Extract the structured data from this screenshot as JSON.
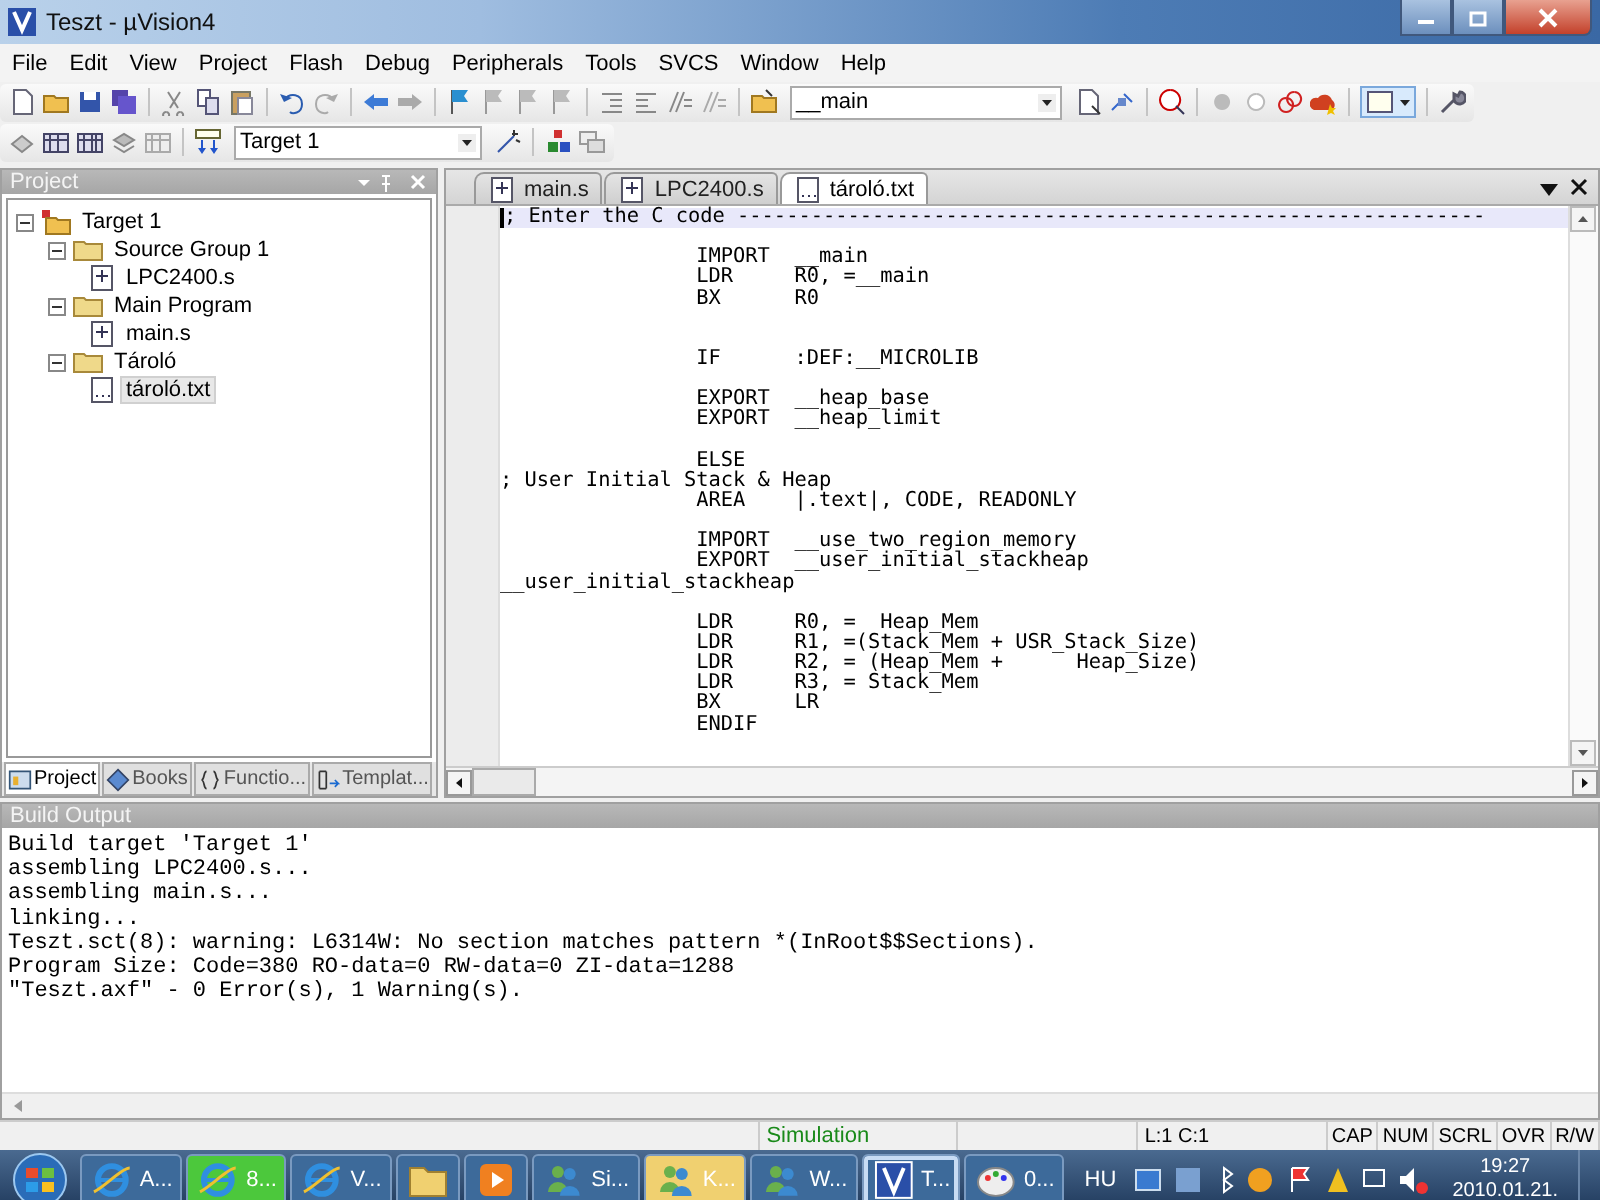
{
  "window": {
    "title": "Teszt  - µVision4"
  },
  "menu": [
    "File",
    "Edit",
    "View",
    "Project",
    "Flash",
    "Debug",
    "Peripherals",
    "Tools",
    "SVCS",
    "Window",
    "Help"
  ],
  "toolbar": {
    "function_combo": {
      "value": "__main"
    },
    "target_combo": {
      "value": "Target 1"
    }
  },
  "project_panel": {
    "title": "Project",
    "tree": [
      {
        "label": "Target 1",
        "kind": "target",
        "expanded": true,
        "selected": false,
        "children": [
          {
            "label": "Source Group 1",
            "kind": "group",
            "expanded": true,
            "selected": false,
            "children": [
              {
                "label": "LPC2400.s",
                "kind": "asm-file",
                "selected": false
              }
            ]
          },
          {
            "label": "Main Program",
            "kind": "group",
            "expanded": true,
            "selected": false,
            "children": [
              {
                "label": "main.s",
                "kind": "asm-file",
                "selected": false
              }
            ]
          },
          {
            "label": "Tároló",
            "kind": "group",
            "expanded": true,
            "selected": false,
            "children": [
              {
                "label": "tároló.txt",
                "kind": "text-file",
                "selected": true
              }
            ]
          }
        ]
      }
    ],
    "tabs": [
      {
        "label": "Project",
        "kind": "project",
        "selected": true
      },
      {
        "label": "Books",
        "kind": "books",
        "selected": false
      },
      {
        "label": "Functio...",
        "kind": "functions",
        "selected": false
      },
      {
        "label": "Templat...",
        "kind": "templates",
        "selected": false
      }
    ]
  },
  "editor": {
    "tabs": [
      {
        "label": "main.s",
        "kind": "asm-file",
        "selected": false
      },
      {
        "label": "LPC2400.s",
        "kind": "asm-file",
        "selected": false
      },
      {
        "label": "tároló.txt",
        "kind": "text-file",
        "selected": true
      }
    ],
    "lines": [
      {
        "kind": "code",
        "text": "; Enter the C code -------------------------------------------------------------",
        "current": true
      },
      {
        "kind": "blank",
        "current": false
      },
      {
        "kind": "code",
        "text": "                IMPORT  __main",
        "current": false
      },
      {
        "kind": "code",
        "text": "                LDR     R0, =__main",
        "current": false
      },
      {
        "kind": "code",
        "text": "                BX      R0",
        "current": false
      },
      {
        "kind": "blank",
        "current": false
      },
      {
        "kind": "blank",
        "current": false
      },
      {
        "kind": "code",
        "text": "                IF      :DEF:__MICROLIB",
        "current": false
      },
      {
        "kind": "blank",
        "current": false
      },
      {
        "kind": "code",
        "text": "                EXPORT  __heap_base",
        "current": false
      },
      {
        "kind": "code",
        "text": "                EXPORT  __heap_limit",
        "current": false
      },
      {
        "kind": "blank",
        "current": false
      },
      {
        "kind": "code",
        "text": "                ELSE",
        "current": false
      },
      {
        "kind": "code",
        "text": "; User Initial Stack & Heap",
        "current": false
      },
      {
        "kind": "code",
        "text": "                AREA    |.text|, CODE, READONLY",
        "current": false
      },
      {
        "kind": "blank",
        "current": false
      },
      {
        "kind": "code",
        "text": "                IMPORT  __use_two_region_memory",
        "current": false
      },
      {
        "kind": "code",
        "text": "                EXPORT  __user_initial_stackheap",
        "current": false
      },
      {
        "kind": "code",
        "text": "__user_initial_stackheap",
        "current": false
      },
      {
        "kind": "blank",
        "current": false
      },
      {
        "kind": "code",
        "text": "                LDR     R0, =  Heap_Mem",
        "current": false
      },
      {
        "kind": "code",
        "text": "                LDR     R1, =(Stack_Mem + USR_Stack_Size)",
        "current": false
      },
      {
        "kind": "code",
        "text": "                LDR     R2, = (Heap_Mem +      Heap_Size)",
        "current": false
      },
      {
        "kind": "code",
        "text": "                LDR     R3, = Stack_Mem",
        "current": false
      },
      {
        "kind": "code",
        "text": "                BX      LR",
        "current": false
      },
      {
        "kind": "code",
        "text": "                ENDIF",
        "current": false
      }
    ]
  },
  "build_output": {
    "title": "Build Output",
    "lines": [
      "Build target 'Target 1'",
      "assembling LPC2400.s...",
      "assembling main.s...",
      "linking...",
      "Teszt.sct(8): warning: L6314W: No section matches pattern *(InRoot$$Sections).",
      "Program Size: Code=380 RO-data=0 RW-data=0 ZI-data=1288",
      "\"Teszt.axf\" - 0 Error(s), 1 Warning(s)."
    ]
  },
  "status_bar": {
    "mode": "Simulation",
    "position": "L:1 C:1",
    "indicators": [
      "CAP",
      "NUM",
      "SCRL",
      "OVR",
      "R/W"
    ]
  },
  "taskbar": {
    "items": [
      {
        "label": "A...",
        "kind": "browser",
        "active": false,
        "color": "#3d6a9a"
      },
      {
        "label": "8...",
        "kind": "browser",
        "active": false,
        "color": "#4cc83c"
      },
      {
        "label": "V...",
        "kind": "browser",
        "active": false,
        "color": "#3d6a9a"
      },
      {
        "kind": "folder",
        "active": false,
        "color": "#3d6a9a"
      },
      {
        "kind": "media",
        "active": false,
        "color": "#3d6a9a"
      },
      {
        "label": "Si...",
        "kind": "messenger",
        "active": false,
        "color": "#3d6a9a"
      },
      {
        "label": "K...",
        "kind": "messenger",
        "active": false,
        "color": "#f0d070"
      },
      {
        "label": "W...",
        "kind": "messenger",
        "active": false,
        "color": "#3d6a9a"
      },
      {
        "label": "T...",
        "kind": "uvision",
        "active": true,
        "color": "#3d6a9a"
      },
      {
        "label": "0...",
        "kind": "paint",
        "active": false,
        "color": "#3d6a9a"
      }
    ],
    "language": "HU",
    "time": "19:27",
    "date": "2010.01.21."
  }
}
